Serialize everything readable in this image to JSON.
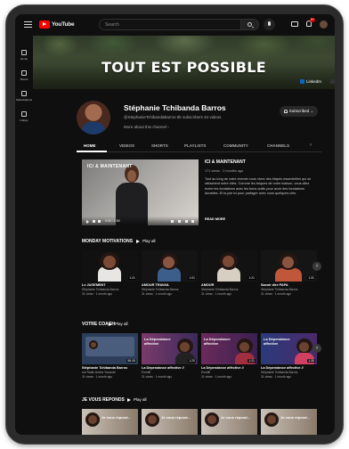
{
  "header": {
    "logo_text": "YouTube",
    "search_placeholder": "Search",
    "notification_count": "9+"
  },
  "sidebar": {
    "items": [
      {
        "label": "Home",
        "icon": "home-icon"
      },
      {
        "label": "Shorts",
        "icon": "shorts-icon"
      },
      {
        "label": "Subscriptions",
        "icon": "subscriptions-icon"
      },
      {
        "label": "Library",
        "icon": "library-icon"
      }
    ]
  },
  "banner": {
    "title": "TOUT EST POSSIBLE",
    "link_label": "LinkedIn"
  },
  "channel": {
    "name": "Stéphanie Tchibanda Barros",
    "meta": "@StephanieTchibandaBarros   8k subscribers   44 videos",
    "description": "More about this channel",
    "subscribe_label": "Subscribed"
  },
  "tabs": [
    "HOME",
    "VIDEOS",
    "SHORTS",
    "PLAYLISTS",
    "COMMUNITY",
    "CHANNELS"
  ],
  "featured": {
    "overlay_label": "ICI & MAINTENANT",
    "title": "ICI & MAINTENANT",
    "stats": "171 views · 2 months ago",
    "description": "Tout au long de votre chemin vous vivez des étapes essentielles qui se rattachent entre elles. Comme les briques de votre maison, vous allez écrire les fondations avec les bons outils pour avoir des fondations durables. Et la joie ici pour partager avec vous quelques clés.",
    "more_label": "READ MORE",
    "time": "0:00 / 1:58"
  },
  "sections": [
    {
      "title": "MONDAY MOTIVATIONS",
      "play_all": "Play all",
      "cards": [
        {
          "title": "Le JUGEMENT",
          "channel": "Stéphanie Tchibanda Barros",
          "meta": "31 views · 1 month ago",
          "duration": "1:21"
        },
        {
          "title": "AMOUR TRAVAIL",
          "channel": "Stéphanie Tchibanda Barros",
          "meta": "31 views · 1 month ago",
          "duration": "1:01"
        },
        {
          "title": "AMOUR",
          "channel": "Stéphanie Tchibanda Barros",
          "meta": "31 views · 1 month ago",
          "duration": "1:21"
        },
        {
          "title": "Savoir dire PAPA",
          "channel": "Stéphanie Tchibanda Barros",
          "meta": "31 views · 1 month ago",
          "duration": "1:31"
        }
      ]
    },
    {
      "title": "VOTRE COACH",
      "play_all": "Play all",
      "cards": [
        {
          "title": "Stéphanie Tchibanda Barros",
          "channel": "sur Radio Amina Yaounde",
          "meta": "31 views · 1 month ago",
          "duration": "58:35",
          "overlay": ""
        },
        {
          "title": "La Dépendance affective //",
          "channel": "Émotif!",
          "meta": "31 views · 1 month ago",
          "duration": "1:20",
          "overlay": "La Dépendance affective"
        },
        {
          "title": "La Dépendance affective //",
          "channel": "Émotif!",
          "meta": "31 views · 1 month ago",
          "duration": "1:21",
          "overlay": "La Dépendance affective"
        },
        {
          "title": "La Dépendance affective //",
          "channel": "Stéphanie Tchibanda Barros",
          "meta": "31 views · 1 month ago",
          "duration": "1:35",
          "overlay": "La Dépendance affective"
        }
      ]
    },
    {
      "title": "JE VOUS REPONDS",
      "play_all": "Play all",
      "cards": [
        {
          "overlay": "Je vous répond..."
        },
        {
          "overlay": "Je vous répond..."
        },
        {
          "overlay": "Je vous répond..."
        },
        {
          "overlay": "Je vous répond..."
        }
      ]
    }
  ],
  "colors": {
    "background": "#0f0f0f",
    "accent_red": "#ff0000",
    "linkedin_blue": "#0a66c2"
  }
}
